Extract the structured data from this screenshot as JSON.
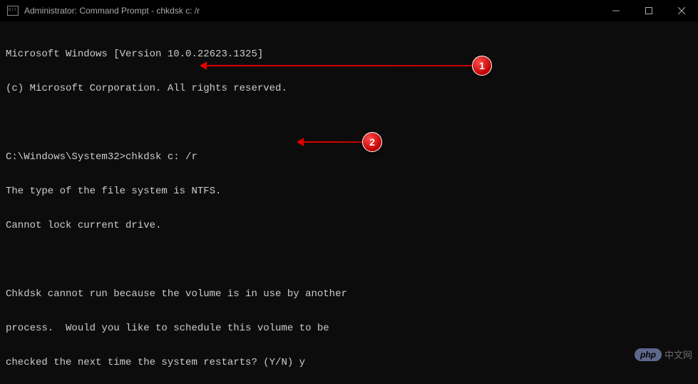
{
  "titlebar": {
    "title": "Administrator: Command Prompt - chkdsk  c: /r"
  },
  "terminal": {
    "lines": [
      "Microsoft Windows [Version 10.0.22623.1325]",
      "(c) Microsoft Corporation. All rights reserved.",
      "",
      "C:\\Windows\\System32>chkdsk c: /r",
      "The type of the file system is NTFS.",
      "Cannot lock current drive.",
      "",
      "Chkdsk cannot run because the volume is in use by another",
      "process.  Would you like to schedule this volume to be",
      "checked the next time the system restarts? (Y/N) y"
    ]
  },
  "annotations": {
    "badge1": "1",
    "badge2": "2"
  },
  "watermark": {
    "logo": "php",
    "text": "中文网"
  }
}
